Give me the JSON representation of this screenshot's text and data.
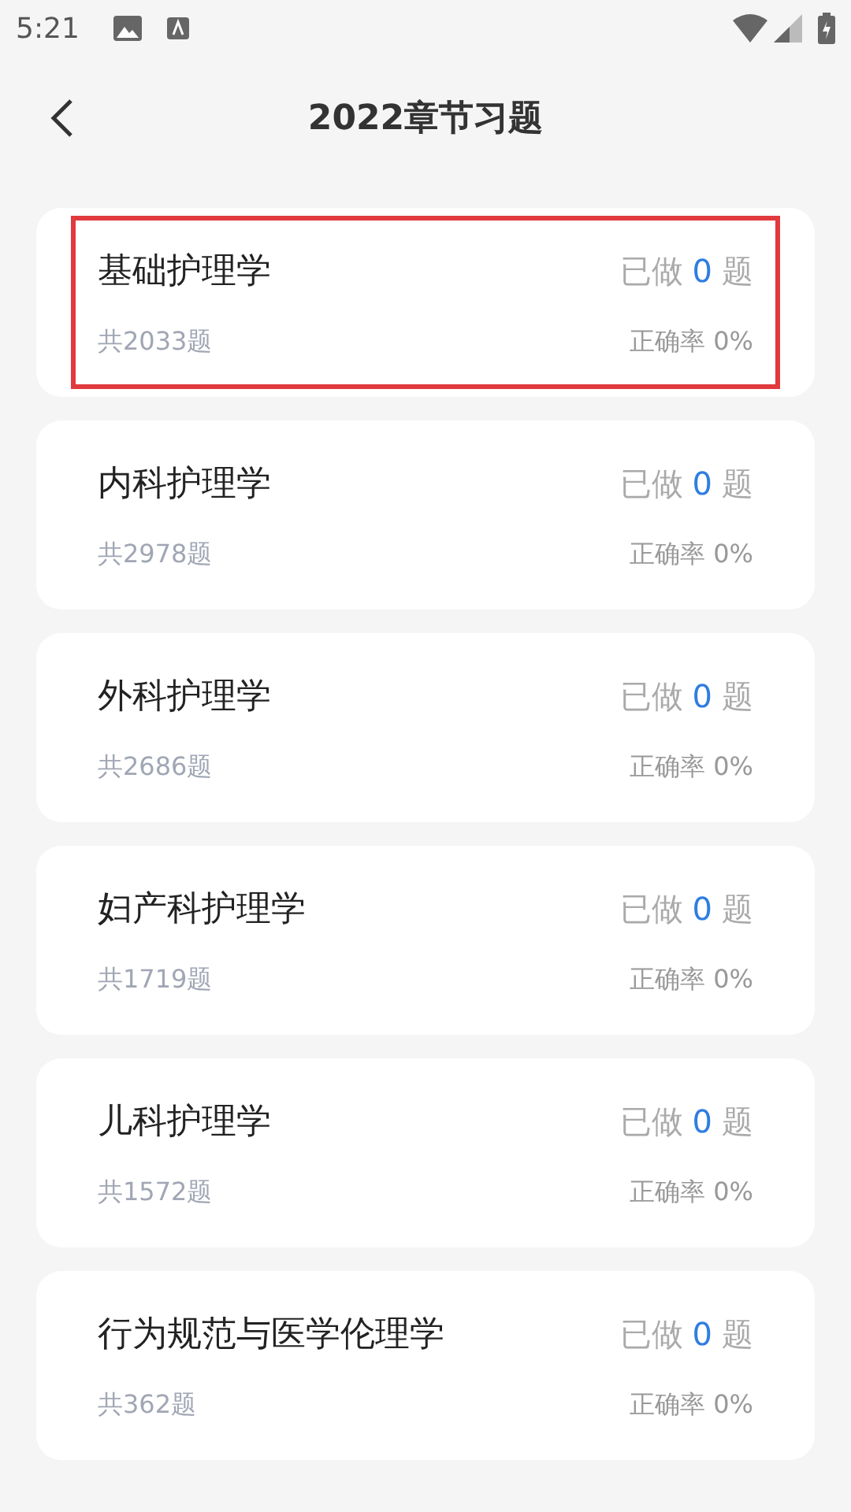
{
  "status_bar": {
    "time": "5:21"
  },
  "header": {
    "title": "2022章节习题"
  },
  "subjects": [
    {
      "name": "基础护理学",
      "total": "共2033题",
      "done_prefix": "已做",
      "done": "0",
      "done_suffix": "题",
      "accuracy": "正确率 0%",
      "selected": true
    },
    {
      "name": "内科护理学",
      "total": "共2978题",
      "done_prefix": "已做",
      "done": "0",
      "done_suffix": "题",
      "accuracy": "正确率 0%",
      "selected": false
    },
    {
      "name": "外科护理学",
      "total": "共2686题",
      "done_prefix": "已做",
      "done": "0",
      "done_suffix": "题",
      "accuracy": "正确率 0%",
      "selected": false
    },
    {
      "name": "妇产科护理学",
      "total": "共1719题",
      "done_prefix": "已做",
      "done": "0",
      "done_suffix": "题",
      "accuracy": "正确率 0%",
      "selected": false
    },
    {
      "name": "儿科护理学",
      "total": "共1572题",
      "done_prefix": "已做",
      "done": "0",
      "done_suffix": "题",
      "accuracy": "正确率 0%",
      "selected": false
    },
    {
      "name": "行为规范与医学伦理学",
      "total": "共362题",
      "done_prefix": "已做",
      "done": "0",
      "done_suffix": "题",
      "accuracy": "正确率 0%",
      "selected": false
    }
  ]
}
